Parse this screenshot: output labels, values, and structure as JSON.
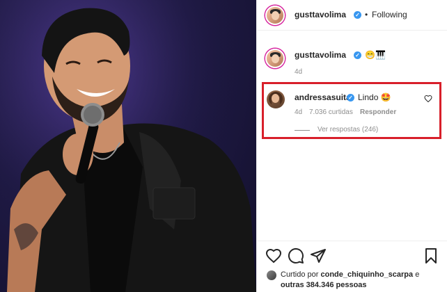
{
  "post": {
    "author": "gusttavolima",
    "follow_dot": "•",
    "follow_status": "Following",
    "caption_emojis": "😁🎹",
    "caption_age": "4d"
  },
  "comment": {
    "username": "andressasuita",
    "text": "Lindo 🤩",
    "age": "4d",
    "likes": "7.036 curtidas",
    "reply_label": "Responder",
    "view_replies": "Ver respostas (246)"
  },
  "likes_summary": {
    "prefix": "Curtido por",
    "liker": "conde_chiquinho_scarpa",
    "connector": "e",
    "others": "outras 384.346 pessoas"
  },
  "icons": {
    "verified": "verified-badge-icon",
    "like": "heart-icon",
    "comment": "comment-bubble-icon",
    "share": "paper-plane-icon",
    "save": "bookmark-icon"
  },
  "colors": {
    "verified_blue": "#3897f0",
    "highlight_red": "#d81f2a",
    "text_primary": "#262626",
    "text_secondary": "#8e8e8e"
  }
}
